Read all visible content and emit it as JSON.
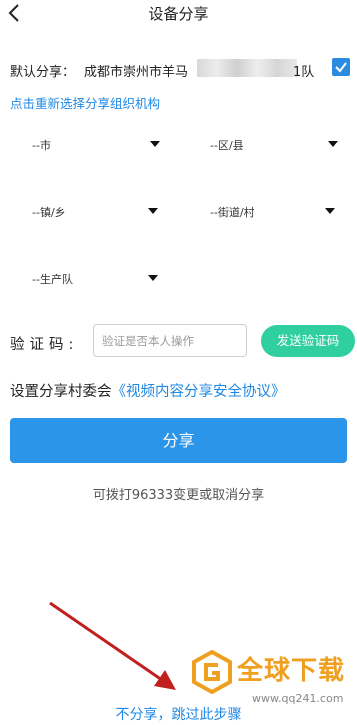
{
  "header": {
    "title": "设备分享",
    "back_icon": "chevron-left-icon"
  },
  "default_share": {
    "label": "默认分享：",
    "value": "成都市崇州市羊马",
    "value_suffix": "1队",
    "checked": true,
    "accent": "#2b8be0"
  },
  "reselect_link": "点击重新选择分享组织机构",
  "selectors": {
    "city": "--市",
    "district": "--区/县",
    "town": "--镇/乡",
    "street": "--街道/村",
    "team": "--生产队"
  },
  "verification": {
    "label": "验证码:",
    "placeholder": "验证是否本人操作",
    "value": "",
    "send_button": "发送验证码",
    "send_color": "#2fcfa0"
  },
  "committee": {
    "label": "设置分享村委会",
    "agreement_link": "《视频内容分享安全协议》"
  },
  "share_button": {
    "label": "分享",
    "color": "#2b95e9"
  },
  "hint": "可拨打96333变更或取消分享",
  "skip_link": "不分享，跳过此步骤",
  "watermark": {
    "text": "全球下载",
    "url": "www.qq241.com"
  }
}
